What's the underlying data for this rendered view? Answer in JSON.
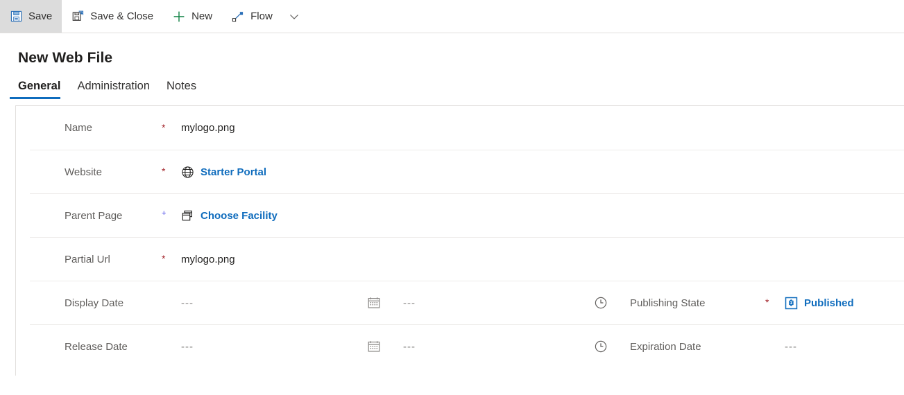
{
  "commandbar": {
    "buttons": [
      {
        "label": "Save",
        "icon": "save-icon",
        "active": true
      },
      {
        "label": "Save & Close",
        "icon": "save-and-close-icon",
        "active": false
      },
      {
        "label": "New",
        "icon": "plus-icon",
        "active": false
      },
      {
        "label": "Flow",
        "icon": "flow-icon",
        "active": false
      }
    ],
    "overflow_icon": "chevron-down-icon"
  },
  "page": {
    "title": "New Web File"
  },
  "tabs": [
    {
      "label": "General",
      "selected": true
    },
    {
      "label": "Administration",
      "selected": false
    },
    {
      "label": "Notes",
      "selected": false
    }
  ],
  "form": {
    "rows": [
      {
        "label": "Name",
        "required": "*",
        "required_kind": "required",
        "value": "mylogo.png",
        "value_kind": "text",
        "icon": ""
      },
      {
        "label": "Website",
        "required": "*",
        "required_kind": "required",
        "value": "Starter Portal",
        "value_kind": "link",
        "icon": "globe-icon"
      },
      {
        "label": "Parent Page",
        "required": "+",
        "required_kind": "recommended",
        "value": "Choose Facility",
        "value_kind": "link",
        "icon": "pages-icon"
      },
      {
        "label": "Partial Url",
        "required": "*",
        "required_kind": "required",
        "value": "mylogo.png",
        "value_kind": "text",
        "icon": ""
      }
    ],
    "date_rows": [
      {
        "label": "Display Date",
        "date_value": "---",
        "date_icon": "calendar-icon",
        "time_value": "---",
        "time_icon": "clock-icon",
        "right_label": "Publishing State",
        "right_required": "*",
        "right_required_kind": "required",
        "right_value": "Published",
        "right_value_kind": "link",
        "right_icon": "entity-icon"
      },
      {
        "label": "Release Date",
        "date_value": "---",
        "date_icon": "calendar-icon",
        "time_value": "---",
        "time_icon": "clock-icon",
        "right_label": "Expiration Date",
        "right_required": "",
        "right_required_kind": "blank",
        "right_value": "---",
        "right_value_kind": "muted",
        "right_icon": ""
      }
    ]
  },
  "colors": {
    "accent": "#0f6cbd",
    "required": "#a4262c",
    "recommended": "#4a4ae8",
    "label": "#605e5c",
    "divider": "#e1dfdd",
    "active_button_bg": "#dcdcdc",
    "new_icon_green": "#0f8043"
  }
}
